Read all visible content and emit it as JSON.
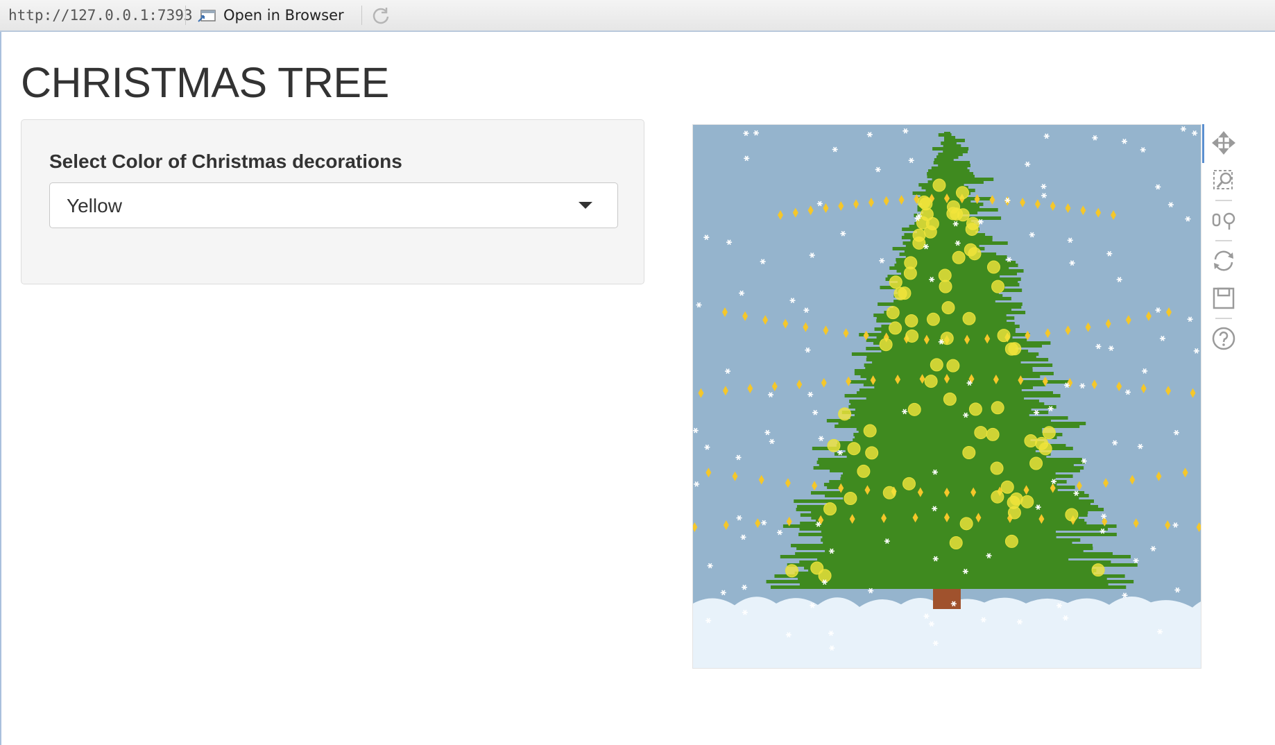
{
  "browser": {
    "url": "http://127.0.0.1:7393",
    "open_in_browser_label": "Open in Browser"
  },
  "page": {
    "title": "CHRISTMAS TREE"
  },
  "sidebar": {
    "select_label": "Select Color of Christmas decorations",
    "select_value": "Yellow"
  },
  "plot": {
    "background_color": "#95b4cd",
    "snow_color": "#e8f2fa",
    "tree_color": "#3f8a1f",
    "trunk_color": "#a0522d",
    "decoration_color": "#f2e53b",
    "modebar_icons": [
      "pan-icon",
      "zoom-icon",
      "compare-icon",
      "reset-icon",
      "save-icon",
      "help-icon"
    ]
  }
}
